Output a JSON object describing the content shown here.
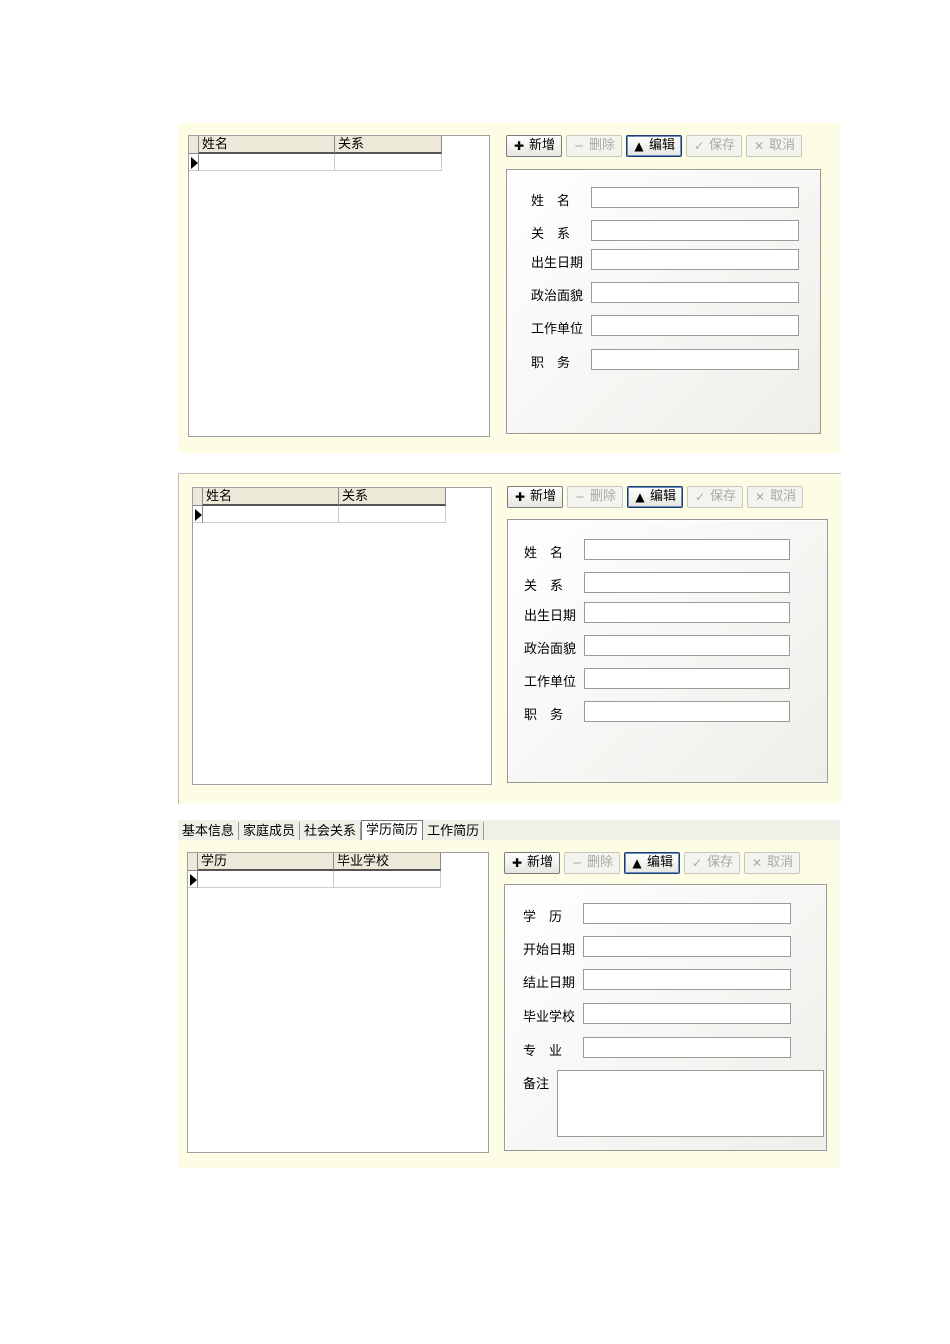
{
  "toolbar": {
    "add": "新增",
    "delete": "删除",
    "edit": "编辑",
    "save": "保存",
    "cancel": "取消"
  },
  "family_grid": {
    "columns": [
      "姓名",
      "关系"
    ]
  },
  "family_form": {
    "labels": [
      "姓　名",
      "关　系",
      "出生日期",
      "政治面貌",
      "工作单位",
      "职　务"
    ]
  },
  "tabs": [
    "基本信息",
    "家庭成员",
    "社会关系",
    "学历简历",
    "工作简历"
  ],
  "active_tab": "学历简历",
  "education_grid": {
    "columns": [
      "学历",
      "毕业学校"
    ]
  },
  "education_form": {
    "labels": [
      "学　历",
      "开始日期",
      "结止日期",
      "毕业学校",
      "专　业",
      "备注"
    ]
  },
  "icons": {
    "add": "plus-icon",
    "delete": "minus-icon",
    "edit": "up-triangle-icon",
    "save": "check-icon",
    "cancel": "cross-icon"
  }
}
